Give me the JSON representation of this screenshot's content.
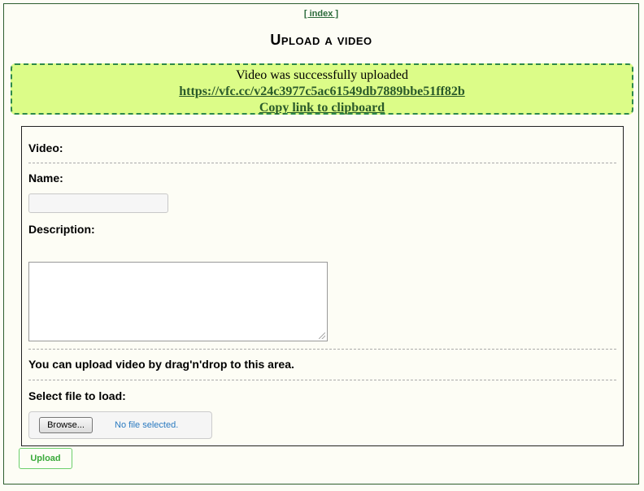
{
  "nav": {
    "index_label": "[ index ]"
  },
  "page": {
    "title": "Upload a video"
  },
  "success": {
    "message": "Video was successfully uploaded",
    "link": "https://vfc.cc/v24c3977c5ac61549db7889bbe51ff82b",
    "copy_label": "Copy link to clipboard"
  },
  "form": {
    "video_label": "Video:",
    "name_label": "Name:",
    "name_value": "",
    "description_label": "Description:",
    "description_value": "",
    "drag_hint": "You can upload video by drag'n'drop to this area.",
    "file_label": "Select file to load:",
    "browse_label": "Browse...",
    "no_file_text": "No file selected."
  },
  "actions": {
    "upload_label": "Upload"
  },
  "colors": {
    "success_bg": "#dcfc88",
    "success_border": "#2e8a4a",
    "link": "#2a5a2a",
    "upload_text": "#3aaa3a"
  }
}
